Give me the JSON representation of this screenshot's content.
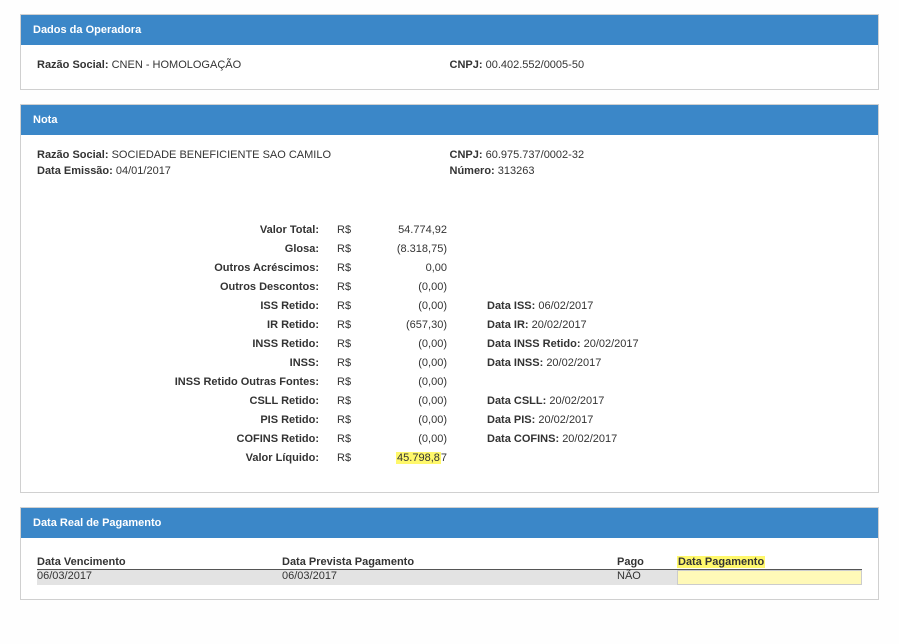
{
  "operadora": {
    "title": "Dados da Operadora",
    "razao_label": "Razão Social:",
    "razao_value": "CNEN - HOMOLOGAÇÃO",
    "cnpj_label": "CNPJ:",
    "cnpj_value": "00.402.552/0005-50"
  },
  "nota": {
    "title": "Nota",
    "razao_label": "Razão Social:",
    "razao_value": "SOCIEDADE BENEFICIENTE SAO CAMILO",
    "cnpj_label": "CNPJ:",
    "cnpj_value": "60.975.737/0002-32",
    "emissao_label": "Data Emissão:",
    "emissao_value": "04/01/2017",
    "numero_label": "Número:",
    "numero_value": "313263",
    "currency": "R$",
    "finance": {
      "valor_total_label": "Valor Total:",
      "valor_total": "54.774,92",
      "glosa_label": "Glosa:",
      "glosa": "(8.318,75)",
      "outros_acrescimos_label": "Outros Acréscimos:",
      "outros_acrescimos": "0,00",
      "outros_descontos_label": "Outros Descontos:",
      "outros_descontos": "(0,00)",
      "iss_retido_label": "ISS Retido:",
      "iss_retido": "(0,00)",
      "ir_retido_label": "IR Retido:",
      "ir_retido": "(657,30)",
      "inss_retido_label": "INSS Retido:",
      "inss_retido": "(0,00)",
      "inss_label": "INSS:",
      "inss": "(0,00)",
      "inss_retido_outras_label": "INSS Retido Outras Fontes:",
      "inss_retido_outras": "(0,00)",
      "csll_retido_label": "CSLL Retido:",
      "csll_retido": "(0,00)",
      "pis_retido_label": "PIS Retido:",
      "pis_retido": "(0,00)",
      "cofins_retido_label": "COFINS Retido:",
      "cofins_retido": "(0,00)",
      "valor_liquido_label": "Valor Líquido:",
      "valor_liquido_hl": "45.798,8",
      "valor_liquido_tail": "7"
    },
    "dates": {
      "iss_label": "Data ISS:",
      "iss": "06/02/2017",
      "ir_label": "Data IR:",
      "ir": "20/02/2017",
      "inssret_label": "Data INSS Retido:",
      "inssret": "20/02/2017",
      "inss_label": "Data INSS:",
      "inss": "20/02/2017",
      "csll_label": "Data CSLL:",
      "csll": "20/02/2017",
      "pis_label": "Data PIS:",
      "pis": "20/02/2017",
      "cofins_label": "Data COFINS:",
      "cofins": "20/02/2017"
    }
  },
  "pagamento": {
    "title": "Data Real de Pagamento",
    "h1": "Data Vencimento",
    "h2": "Data Prevista Pagamento",
    "h3": "Pago",
    "h4": "Data Pagamento",
    "v1": "06/03/2017",
    "v2": "06/03/2017",
    "v3": "NÃO"
  }
}
